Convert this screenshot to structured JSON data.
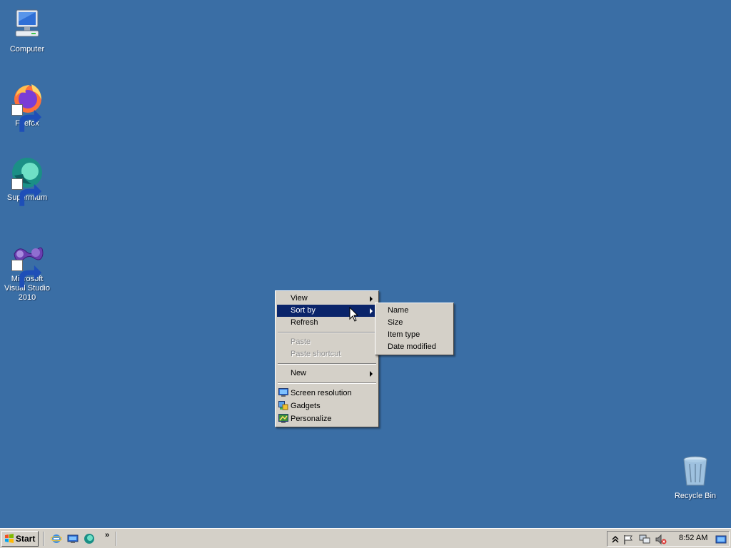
{
  "desktop": {
    "background_color": "#3a6ea5",
    "icons": [
      {
        "label": "Computer",
        "icon": "computer-icon"
      },
      {
        "label": "Firefox",
        "icon": "firefox-icon"
      },
      {
        "label": "Supermium",
        "icon": "supermium-icon"
      },
      {
        "label": "Microsoft Visual Studio 2010",
        "icon": "visual-studio-icon"
      },
      {
        "label": "Recycle Bin",
        "icon": "recycle-bin-icon"
      }
    ]
  },
  "context_menu": {
    "items": [
      {
        "label": "View",
        "submenu": true
      },
      {
        "label": "Sort by",
        "submenu": true,
        "highlighted": true
      },
      {
        "label": "Refresh"
      },
      {
        "label": "Paste",
        "disabled": true
      },
      {
        "label": "Paste shortcut",
        "disabled": true
      },
      {
        "label": "New",
        "submenu": true
      },
      {
        "label": "Screen resolution",
        "icon": "screen-resolution-icon"
      },
      {
        "label": "Gadgets",
        "icon": "gadgets-icon"
      },
      {
        "label": "Personalize",
        "icon": "personalize-icon"
      }
    ],
    "highlight_color": "#0a246a"
  },
  "sort_submenu": {
    "items": [
      "Name",
      "Size",
      "Item type",
      "Date modified"
    ]
  },
  "taskbar": {
    "start_label": "Start",
    "quick_launch": [
      "internet-explorer-icon",
      "show-desktop-icon",
      "supermium-icon"
    ],
    "overflow": "»",
    "tray_icons": [
      "show-hidden-icons-icon",
      "action-center-flag-icon",
      "network-icon",
      "volume-muted-icon"
    ],
    "clock": "8:52 AM"
  }
}
